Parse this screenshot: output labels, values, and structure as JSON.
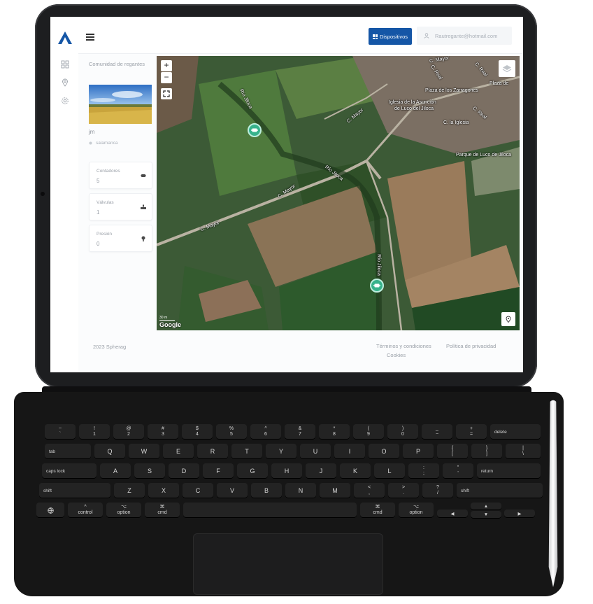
{
  "topbar": {
    "devices_button": "Dispositivos",
    "user_email": "Rautregante@hotmail.com"
  },
  "info": {
    "community": "Comunidad de regantes",
    "name": "jm",
    "location": "salamanca",
    "cards": [
      {
        "label": "Contadores",
        "value": "5",
        "icon": "meter-icon"
      },
      {
        "label": "Válvulas",
        "value": "1",
        "icon": "valve-icon"
      },
      {
        "label": "Presión",
        "value": "0",
        "icon": "pressure-icon"
      }
    ]
  },
  "map": {
    "zoom_in": "+",
    "zoom_out": "−",
    "labels": {
      "rio1": "Río Jiloca",
      "rio2": "Río Jiloca",
      "rio3": "Río Jiloca",
      "cmayor1": "C. Mayor",
      "cmayor2": "C. Mayor",
      "cmayor3": "C. Mayor",
      "cmayor4": "C. Mayor",
      "plaza": "Plaza de los Zarragones",
      "plaza2": "Plaza de",
      "iglesia1": "Iglesia de la Asunción",
      "iglesia2": "de Luco del Jiloca",
      "c_iglesia": "C. la Iglesia",
      "c_real1": "C. Real",
      "c_real2": "C. Real",
      "c_real3": "C. Real",
      "parque": "Parque de Luco de Jiloca",
      "scale": "30 m",
      "google": "Google"
    }
  },
  "footer": {
    "copyright": "2023 Spherag",
    "terms": "Términos y condiciones",
    "privacy": "Política de privacidad",
    "cookies": "Cookies"
  },
  "keyboard": {
    "row1": [
      [
        "~",
        "`"
      ],
      [
        "!",
        "1"
      ],
      [
        "@",
        "2"
      ],
      [
        "#",
        "3"
      ],
      [
        "$",
        "4"
      ],
      [
        "%",
        "5"
      ],
      [
        "^",
        "6"
      ],
      [
        "&",
        "7"
      ],
      [
        "*",
        "8"
      ],
      [
        "(",
        "9"
      ],
      [
        ")",
        "0"
      ],
      [
        "_",
        "−"
      ],
      [
        "+",
        "="
      ]
    ],
    "delete": "delete",
    "tab": "tab",
    "row2": [
      "Q",
      "W",
      "E",
      "R",
      "T",
      "Y",
      "U",
      "I",
      "O",
      "P"
    ],
    "row2b": [
      [
        "{",
        "["
      ],
      [
        "}",
        "]"
      ],
      [
        "|",
        "\\"
      ]
    ],
    "capslock": "caps lock",
    "row3": [
      "A",
      "S",
      "D",
      "F",
      "G",
      "H",
      "J",
      "K",
      "L"
    ],
    "row3b": [
      [
        ":",
        ";"
      ],
      [
        "\"",
        "'"
      ]
    ],
    "return": "return",
    "shift": "shift",
    "row4": [
      "Z",
      "X",
      "C",
      "V",
      "B",
      "N",
      "M"
    ],
    "row4b": [
      [
        "<",
        ","
      ],
      [
        ">",
        "."
      ],
      [
        "?",
        "/"
      ]
    ],
    "control": "control",
    "option": "option",
    "cmd": "cmd",
    "ctrl_sym": "^",
    "opt_sym": "⌥",
    "cmd_sym": "⌘"
  }
}
